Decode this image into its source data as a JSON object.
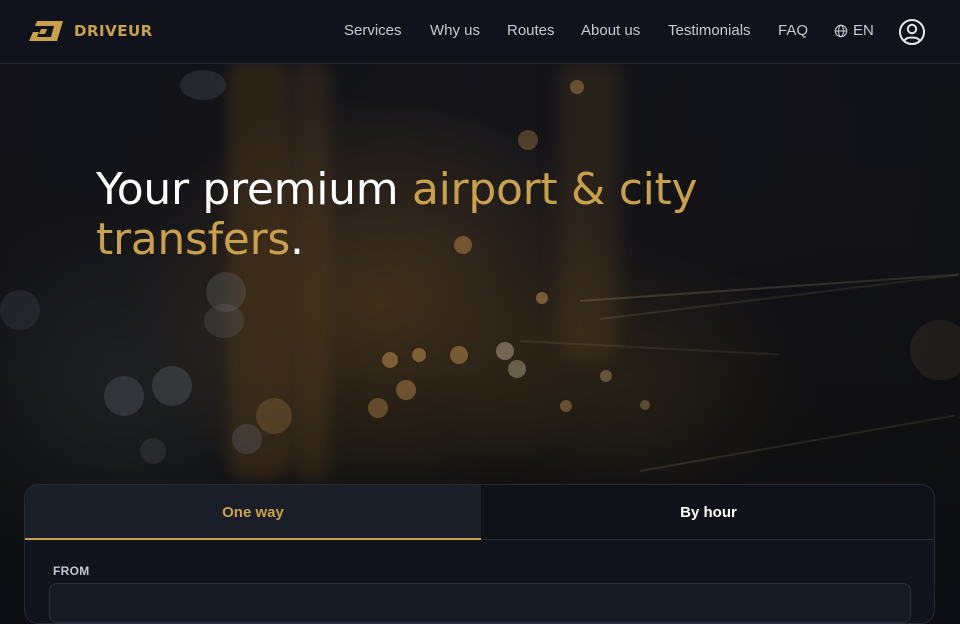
{
  "brand": {
    "name": "DRIVEUR",
    "accent": "#c9a04e"
  },
  "nav": {
    "items": [
      {
        "label": "Services"
      },
      {
        "label": "Why us"
      },
      {
        "label": "Routes"
      },
      {
        "label": "About us"
      },
      {
        "label": "Testimonials"
      },
      {
        "label": "FAQ"
      }
    ],
    "language": {
      "icon": "globe-icon",
      "label": "EN"
    },
    "account_icon": "user-circle-icon"
  },
  "hero": {
    "headline_part1": "Your premium ",
    "headline_highlight": "airport & city transfers",
    "headline_end": "."
  },
  "booking": {
    "tabs": [
      {
        "label": "One way",
        "active": true
      },
      {
        "label": "By hour",
        "active": false
      }
    ],
    "from_label": "FROM",
    "from_value": ""
  }
}
